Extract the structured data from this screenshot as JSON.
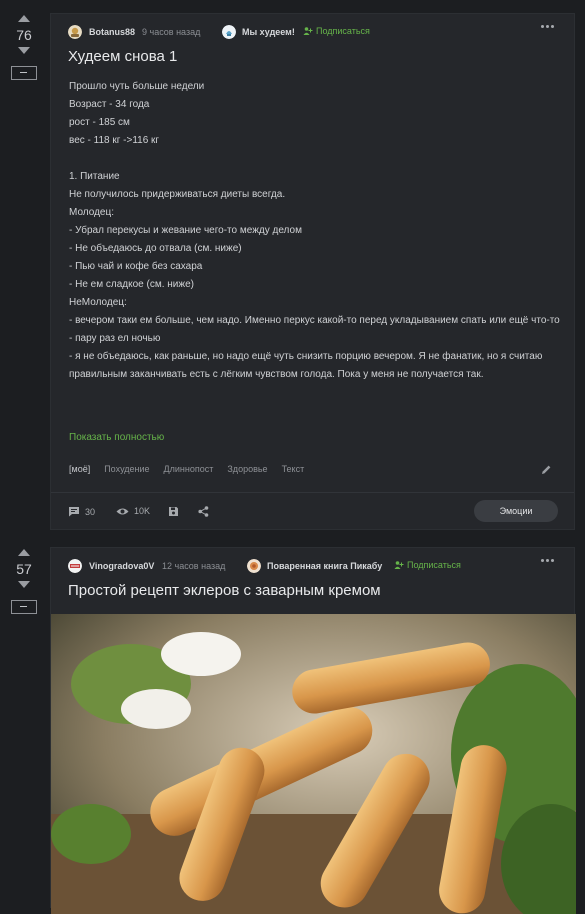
{
  "posts": [
    {
      "score": "76",
      "author": "Botanus88",
      "time": "9 часов назад",
      "community": "Мы худеем!",
      "subscribe": "Подписаться",
      "title": "Худеем снова 1",
      "body": [
        "Прошло чуть больше недели",
        "Возраст - 34 года",
        "рост - 185 см",
        "вес - 118 кг ->116 кг",
        "",
        "1. Питание",
        "Не получилось придерживаться диеты всегда.",
        "Молодец:",
        "- Убрал перекусы и жевание чего-то между делом",
        "- Не объедаюсь до отвала (см. ниже)",
        "- Пью чай и кофе без сахара",
        "- Не ем сладкое (см. ниже)",
        "НеМолодец:",
        "- вечером таки ем больше, чем надо. Именно перкус какой-то перед укладыванием спать или ещё что-то",
        "- пару раз ел ночью",
        "- я не объедаюсь, как раньше, но надо ещё чуть снизить порцию вечером. Я не фанатик, но я считаю правильным заканчивать есть с лёгким чувством голода. Пока у меня не получается так."
      ],
      "show_more": "Показать полностью",
      "tags": [
        "[моё]",
        "Похудение",
        "Длиннопост",
        "Здоровье",
        "Текст"
      ],
      "comments": "30",
      "views": "10K",
      "emotions": "Эмоции"
    },
    {
      "score": "57",
      "author": "Vinogradova0V",
      "time": "12 часов назад",
      "community": "Поваренная книга Пикабу",
      "subscribe": "Подписаться",
      "title": "Простой рецепт эклеров с заварным кремом"
    }
  ],
  "icons": [
    "arrow-up-icon",
    "arrow-down-icon",
    "minus-icon",
    "menu-dots-icon",
    "subscribe-icon",
    "comment-icon",
    "eye-icon",
    "save-icon",
    "share-icon",
    "edit-icon"
  ],
  "colors": {
    "background": "#1c1e21",
    "card": "#25272b",
    "accent_green": "#66b44a",
    "text": "#d9d9d9"
  }
}
